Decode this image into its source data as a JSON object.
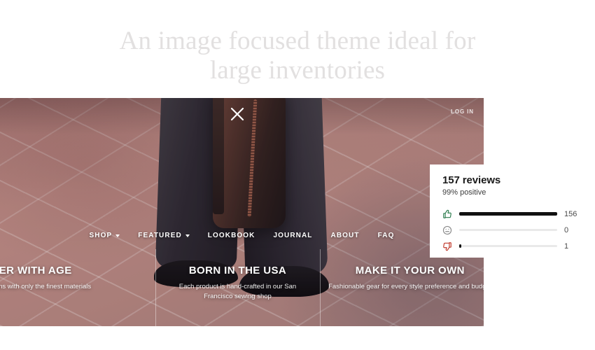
{
  "headline": "An image focused theme ideal for\nlarge inventories",
  "hero": {
    "login_label": "LOG IN",
    "close_icon": "close-icon",
    "nav": [
      {
        "label": "SHOP",
        "has_chevron": true
      },
      {
        "label": "FEATURED",
        "has_chevron": true
      },
      {
        "label": "LOOKBOOK",
        "has_chevron": false
      },
      {
        "label": "JOURNAL",
        "has_chevron": false
      },
      {
        "label": "ABOUT",
        "has_chevron": false
      },
      {
        "label": "FAQ",
        "has_chevron": false
      }
    ],
    "cards": [
      {
        "title": "BETTER WITH AGE",
        "body": "ess designs with only the finest materials"
      },
      {
        "title": "BORN IN THE USA",
        "body": "Each product is hand-crafted in our San Francisco sewing shop"
      },
      {
        "title": "MAKE IT YOUR OWN",
        "body": "Fashionable gear for every style preference and budget"
      }
    ]
  },
  "reviews": {
    "title": "157 reviews",
    "subtitle": "99% positive",
    "rows": [
      {
        "icon": "thumbs-up-icon",
        "value": "156",
        "fill_percent": 100,
        "color": "#2e7d4f"
      },
      {
        "icon": "neutral-face-icon",
        "value": "0",
        "fill_percent": 0,
        "color": "#8a8a8a"
      },
      {
        "icon": "thumbs-down-icon",
        "value": "1",
        "fill_percent": 1.5,
        "color": "#c0392b"
      }
    ]
  },
  "colors": {
    "headline": "#e2e0e0",
    "panel_bg": "#ffffff",
    "bar_fill": "#111111",
    "bar_track": "#e9e9e9"
  }
}
